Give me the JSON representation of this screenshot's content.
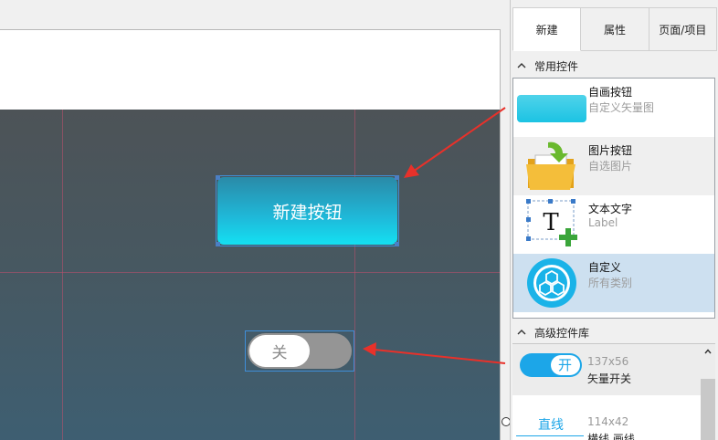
{
  "canvas": {
    "new_button_label": "新建按钮",
    "switch_off_label": "关"
  },
  "panel": {
    "tabs": [
      {
        "label": "新建",
        "active": true
      },
      {
        "label": "属性",
        "active": false
      },
      {
        "label": "页面/项目",
        "active": false
      }
    ],
    "common_section": {
      "title": "常用控件",
      "items": [
        {
          "title": "自画按钮",
          "subtitle": "自定义矢量图",
          "icon": "gradient-button-icon"
        },
        {
          "title": "图片按钮",
          "subtitle": "自选图片",
          "icon": "folder-image-icon"
        },
        {
          "title": "文本文字",
          "subtitle": "Label",
          "icon": "text-label-icon"
        },
        {
          "title": "自定义",
          "subtitle": "所有类别",
          "icon": "custom-component-icon",
          "selected": true
        }
      ]
    },
    "advanced_section": {
      "title": "高级控件库",
      "items": [
        {
          "size": "137x56",
          "name": "矢量开关",
          "preview_label": "开"
        },
        {
          "size": "114x42",
          "name": "横线 画线",
          "preview_label": "直线"
        }
      ]
    }
  },
  "colors": {
    "accent": "#1fb9d9",
    "selection_border": "#3f8ed8",
    "arrow": "#e8312a",
    "selected_row": "#cde0f0"
  }
}
